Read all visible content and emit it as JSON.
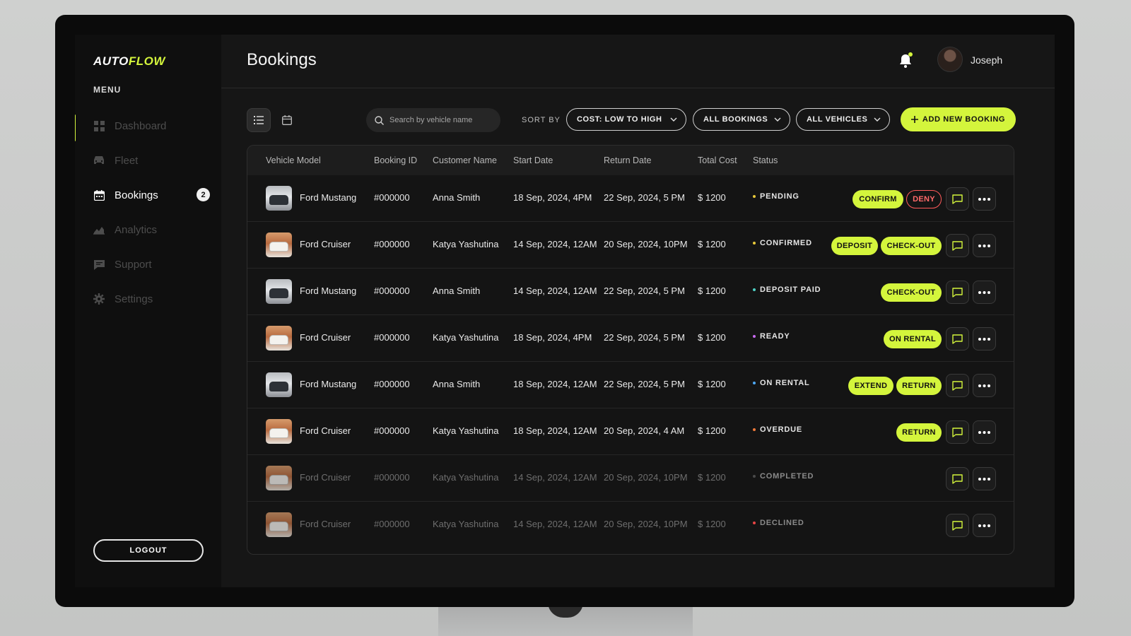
{
  "brand": {
    "logo_main": "AUTO",
    "logo_accent": "FLOW",
    "accent_color": "#d4f53c"
  },
  "sidebar": {
    "menu_label": "MENU",
    "items": [
      {
        "label": "Dashboard",
        "icon": "grid-icon"
      },
      {
        "label": "Fleet",
        "icon": "car-icon"
      },
      {
        "label": "Bookings",
        "icon": "calendar-icon",
        "active": true,
        "badge": "2"
      },
      {
        "label": "Analytics",
        "icon": "chart-icon"
      },
      {
        "label": "Support",
        "icon": "chat-icon"
      },
      {
        "label": "Settings",
        "icon": "gear-icon"
      }
    ],
    "logout_label": "LOGOUT"
  },
  "header": {
    "title": "Bookings",
    "user_name": "Joseph"
  },
  "toolbar": {
    "search_placeholder": "Search by vehicle name",
    "sort_label": "SORT BY",
    "sort_value": "COST: LOW TO HIGH",
    "bookings_filter": "ALL BOOKINGS",
    "vehicles_filter": "ALL VEHICLES",
    "add_label": "ADD NEW BOOKING"
  },
  "table": {
    "columns": [
      "Vehicle Model",
      "Booking ID",
      "Customer Name",
      "Start Date",
      "Return Date",
      "Total Cost",
      "Status"
    ],
    "rows": [
      {
        "vehicle": "Ford Mustang",
        "booking_id": "#000000",
        "customer": "Anna Smith",
        "start": "18 Sep, 2024, 4PM",
        "return": "22 Sep, 2024, 5 PM",
        "cost": "$ 1200",
        "status": "PENDING",
        "status_color": "#e8c93a",
        "actions": [
          "CONFIRM",
          "DENY"
        ]
      },
      {
        "vehicle": "Ford Cruiser",
        "booking_id": "#000000",
        "customer": "Katya Yashutina",
        "start": "14 Sep, 2024, 12AM",
        "return": "20 Sep, 2024, 10PM",
        "cost": "$ 1200",
        "status": "CONFIRMED",
        "status_color": "#e8c93a",
        "actions": [
          "DEPOSIT",
          "CHECK-OUT"
        ]
      },
      {
        "vehicle": "Ford Mustang",
        "booking_id": "#000000",
        "customer": "Anna Smith",
        "start": "14 Sep, 2024, 12AM",
        "return": "22 Sep, 2024, 5 PM",
        "cost": "$ 1200",
        "status": "DEPOSIT PAID",
        "status_color": "#4fd1c5",
        "actions": [
          "CHECK-OUT"
        ]
      },
      {
        "vehicle": "Ford Cruiser",
        "booking_id": "#000000",
        "customer": "Katya Yashutina",
        "start": "18 Sep, 2024, 4PM",
        "return": "22 Sep, 2024, 5 PM",
        "cost": "$ 1200",
        "status": "READY",
        "status_color": "#c86bf0",
        "actions": [
          "ON RENTAL"
        ]
      },
      {
        "vehicle": "Ford Mustang",
        "booking_id": "#000000",
        "customer": "Anna Smith",
        "start": "18 Sep, 2024, 12AM",
        "return": "22 Sep, 2024, 5 PM",
        "cost": "$ 1200",
        "status": "ON RENTAL",
        "status_color": "#4ea8f5",
        "actions": [
          "EXTEND",
          "RETURN"
        ]
      },
      {
        "vehicle": "Ford Cruiser",
        "booking_id": "#000000",
        "customer": "Katya Yashutina",
        "start": "18 Sep, 2024, 12AM",
        "return": "20 Sep, 2024, 4 AM",
        "cost": "$ 1200",
        "status": "OVERDUE",
        "status_color": "#f07a3a",
        "actions": [
          "RETURN"
        ]
      },
      {
        "vehicle": "Ford Cruiser",
        "booking_id": "#000000",
        "customer": "Katya Yashutina",
        "start": "14 Sep, 2024, 12AM",
        "return": "20 Sep, 2024, 10PM",
        "cost": "$ 1200",
        "status": "COMPLETED",
        "status_color": "#4a4a4a",
        "actions": [],
        "muted": true
      },
      {
        "vehicle": "Ford Cruiser",
        "booking_id": "#000000",
        "customer": "Katya Yashutina",
        "start": "14 Sep, 2024, 12AM",
        "return": "20 Sep, 2024, 10PM",
        "cost": "$ 1200",
        "status": "DECLINED",
        "status_color": "#e84545",
        "actions": [],
        "muted": true
      }
    ]
  }
}
